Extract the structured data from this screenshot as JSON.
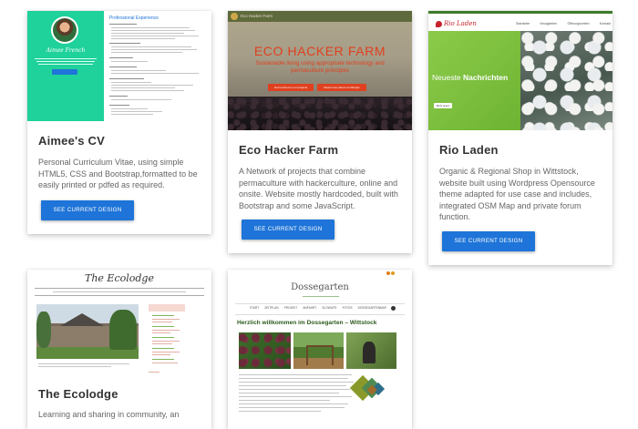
{
  "cards": [
    {
      "title": "Aimee's CV",
      "description": "Personal Curriculum Vitae, using simple HTML5, CSS and Bootstrap,formatted to be easily printed or pdfed as required.",
      "button": "SEE CURRENT DESIGN",
      "preview": {
        "name": "Aimee French",
        "heading": "Professional Experience"
      }
    },
    {
      "title": "Eco Hacker Farm",
      "description": "A Network of projects that combine permaculture with hackerculture, online and onsite. Website mostly hardcoded, built with Bootstrap and some JavaScript.",
      "button": "SEE CURRENT DESIGN",
      "preview": {
        "nav": "Eco Hacker Farm",
        "hero_title": "ECO HACKER FARM",
        "hero_subtitle": "Sustainable living using appropriate technology and permaculture principles",
        "btn1": "Get involved in our projects",
        "btn2": "Read more about our lifestyle"
      }
    },
    {
      "title": "Rio Laden",
      "description": "Organic & Regional Shop in Wittstock, website built using Wordpress Opensource theme adapted for use case and includes, integrated OSM Map and private forum function.",
      "button": "SEE CURRENT DESIGN",
      "preview": {
        "logo": "Rio Laden",
        "nav": [
          "Startseite",
          "Neuigkeiten",
          "Öffnungszeiten",
          "Kontakt"
        ],
        "hero_a": "Neueste ",
        "hero_b": "Nachrichten",
        "hero_btn": "Mehr lesen"
      }
    },
    {
      "title": "The Ecolodge",
      "description": "Learning and sharing in community, an",
      "preview": {
        "logo": "The Ecolodge"
      }
    },
    {
      "title": "",
      "description": "",
      "preview": {
        "logo": "Dossegarten",
        "nav": [
          "START",
          "ZEITPLAN",
          "PROJEKT",
          "ANFAHRT",
          "SLOWLIFE",
          "FOTOS",
          "DOSSEGARTENMAP"
        ],
        "heading": "Herzlich willkommen im Dossegarten – Wittstock"
      }
    }
  ],
  "colors": {
    "accent": "#1e74d8",
    "cv_green": "#1fd19a",
    "eco_red": "#e0401f",
    "rio_green": "#7cc13d",
    "rio_red": "#c8232c"
  }
}
